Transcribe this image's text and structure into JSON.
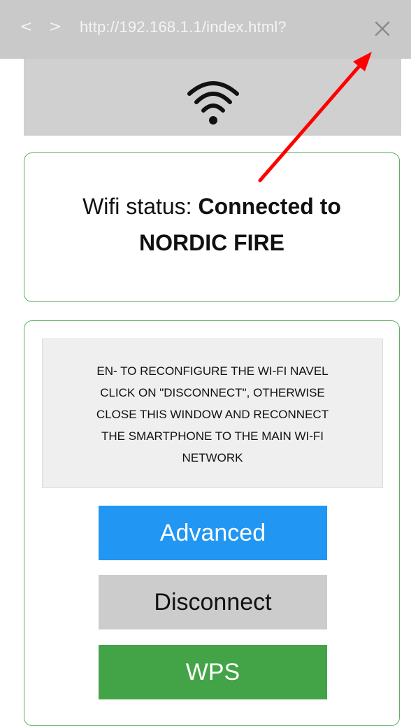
{
  "browser": {
    "back_icon": "chevron-left-icon",
    "back_label": "<",
    "forward_icon": "chevron-right-icon",
    "forward_label": ">",
    "url": "http://192.168.1.1/index.html?",
    "close_icon": "close-icon"
  },
  "header": {
    "icon": "wifi-icon"
  },
  "status": {
    "prefix": "Wifi status: ",
    "value_line1": "Connected to",
    "value_line2": "NORDIC FIRE"
  },
  "notice": {
    "lines": [
      "EN- TO RECONFIGURE THE WI-FI NAVEL",
      "CLICK ON \"DISCONNECT\", OTHERWISE",
      "CLOSE THIS WINDOW AND RECONNECT",
      "THE SMARTPHONE TO THE MAIN WI-FI",
      "NETWORK"
    ]
  },
  "buttons": {
    "advanced": "Advanced",
    "disconnect": "Disconnect",
    "wps": "WPS"
  },
  "colors": {
    "advanced_bg": "#2196f3",
    "disconnect_bg": "#cccccc",
    "wps_bg": "#43a447",
    "card_border": "#5fae63",
    "annotation_arrow": "#ff0000"
  },
  "annotation": {
    "type": "red-arrow",
    "points_to": "close-icon"
  }
}
